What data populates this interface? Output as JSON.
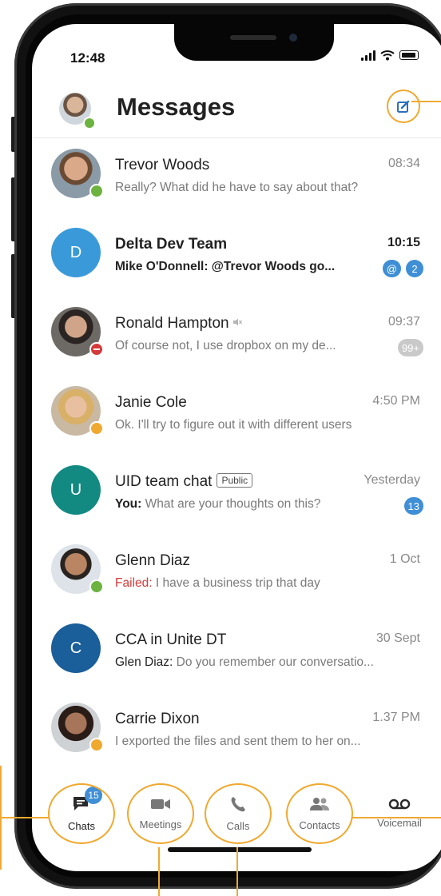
{
  "status_bar": {
    "time": "12:48"
  },
  "header": {
    "title": "Messages",
    "compose_icon": "compose-icon"
  },
  "colors": {
    "accent": "#f0a930",
    "badge": "#3f8fd6",
    "online": "#6cb33f",
    "away": "#f0a930",
    "dnd": "#d33a3a"
  },
  "chats": [
    {
      "name": "Trevor Woods",
      "time": "08:34",
      "prefix": "",
      "prefix_style": "",
      "preview": "Really? What did he have to say about that?",
      "bold": false,
      "avatar": "photo",
      "presence": "online",
      "badges": []
    },
    {
      "name": "Delta Dev Team",
      "time": "10:15",
      "prefix": "",
      "prefix_style": "",
      "preview": "Mike O'Donnell: @Trevor Woods go...",
      "bold": true,
      "avatar": "D",
      "avatar_color": "#3a9ad9",
      "presence": "",
      "badges": [
        "@",
        "2"
      ]
    },
    {
      "name": "Ronald Hampton",
      "time": "09:37",
      "prefix": "",
      "prefix_style": "",
      "preview": "Of course not, I use dropbox on my de...",
      "bold": false,
      "avatar": "photo",
      "presence": "dnd",
      "muted": true,
      "badges": [
        "99+"
      ]
    },
    {
      "name": "Janie Cole",
      "time": "4:50 PM",
      "prefix": "",
      "prefix_style": "",
      "preview": "Ok. I'll try to figure out it with different users",
      "bold": false,
      "avatar": "photo",
      "presence": "away",
      "badges": []
    },
    {
      "name": "UID team chat",
      "tag": "Public",
      "time": "Yesterday",
      "prefix": "You:",
      "prefix_style": "bold",
      "preview": " What are your thoughts on this?",
      "bold": false,
      "avatar": "U",
      "avatar_color": "#128a82",
      "presence": "",
      "badges": [
        "13"
      ]
    },
    {
      "name": "Glenn Diaz",
      "time": "1 Oct",
      "prefix": "Failed:",
      "prefix_style": "red",
      "preview": " I have a business trip that day",
      "bold": false,
      "avatar": "photo",
      "presence": "online",
      "badges": []
    },
    {
      "name": "CCA in Unite DT",
      "time": "30 Sept",
      "prefix": "Glen Diaz:",
      "prefix_style": "dark",
      "preview": " Do you remember our conversatio...",
      "bold": false,
      "avatar": "C",
      "avatar_color": "#1a5e9a",
      "presence": "",
      "badges": []
    },
    {
      "name": "Carrie Dixon",
      "time": "1.37 PM",
      "prefix": "",
      "prefix_style": "",
      "preview": "I exported the files and sent them to her on...",
      "bold": false,
      "avatar": "photo",
      "presence": "away",
      "badges": []
    }
  ],
  "tabs": [
    {
      "label": "Chats",
      "icon": "chat-icon",
      "badge": "15",
      "active": true
    },
    {
      "label": "Meetings",
      "icon": "video-icon"
    },
    {
      "label": "Calls",
      "icon": "phone-icon"
    },
    {
      "label": "Contacts",
      "icon": "contacts-icon"
    },
    {
      "label": "Voicemail",
      "icon": "voicemail-icon"
    }
  ]
}
